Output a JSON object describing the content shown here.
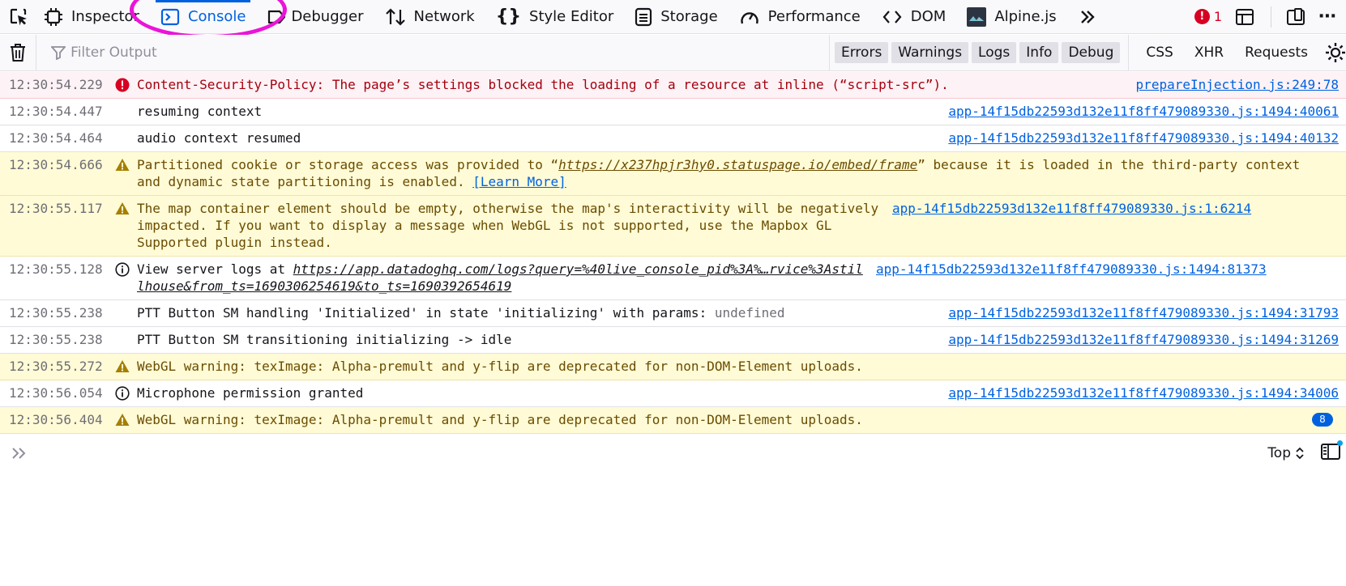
{
  "toolbar": {
    "tabs": [
      {
        "label": "Inspector",
        "icon": "inspector-icon",
        "selected": false
      },
      {
        "label": "Console",
        "icon": "console-icon",
        "selected": true
      },
      {
        "label": "Debugger",
        "icon": "debugger-icon",
        "selected": false
      },
      {
        "label": "Network",
        "icon": "network-icon",
        "selected": false
      },
      {
        "label": "Style Editor",
        "icon": "style-editor-icon",
        "selected": false
      },
      {
        "label": "Storage",
        "icon": "storage-icon",
        "selected": false
      },
      {
        "label": "Performance",
        "icon": "performance-icon",
        "selected": false
      },
      {
        "label": "DOM",
        "icon": "dom-icon",
        "selected": false
      },
      {
        "label": "Alpine.js",
        "icon": "alpine-icon",
        "selected": false
      }
    ],
    "error_count": "1",
    "accent": "#0061e0",
    "annotation_color": "#ea14d8"
  },
  "filter": {
    "placeholder": "Filter Output",
    "levels": [
      "Errors",
      "Warnings",
      "Logs",
      "Info",
      "Debug"
    ],
    "types": [
      "CSS",
      "XHR",
      "Requests"
    ]
  },
  "messages": [
    {
      "type": "error",
      "time": "12:30:54.229",
      "text": "Content-Security-Policy: The page’s settings blocked the loading of a resource at inline (“script-src”).",
      "source": "prepareInjection.js:249:78"
    },
    {
      "type": "log",
      "time": "12:30:54.447",
      "text": "resuming context",
      "source_file": "app-14f15db22593d132e11f8ff479089330.js",
      "source_loc": ":1494:40061"
    },
    {
      "type": "log",
      "time": "12:30:54.464",
      "text": "audio context resumed",
      "source_file": "app-14f15db22593d132e11f8ff479089330.js",
      "source_loc": ":1494:40132"
    },
    {
      "type": "warn",
      "time": "12:30:54.666",
      "text_before": "Partitioned cookie or storage access was provided to “",
      "link": "https://x237hpjr3hy0.statuspage.io/embed/frame",
      "text_after": "” because it is loaded in the third-party context and dynamic state partitioning is enabled. ",
      "learn_more": "[Learn More]"
    },
    {
      "type": "warn",
      "time": "12:30:55.117",
      "text": "The map container element should be empty, otherwise the map's interactivity will be negatively impacted. If you want to display a message when WebGL is not supported, use the Mapbox GL Supported plugin instead.",
      "source_file": "app-14f15db22593d132e11f8ff479089330.js",
      "source_loc": ":1:6214"
    },
    {
      "type": "info",
      "time": "12:30:55.128",
      "text_before": "View server logs at ",
      "link": "https://app.datadoghq.com/logs?query=%40live_console_pid%3A%…rvice%3Astillhouse&from_ts=1690306254619&to_ts=1690392654619",
      "source_file": "app-14f15db22593d132e11f8ff479089330.js",
      "source_loc": ":1494:81373"
    },
    {
      "type": "log",
      "time": "12:30:55.238",
      "text": "PTT Button SM handling 'Initialized' in state 'initializing' with params: ",
      "text_gray": "undefined",
      "source_file": "app-14f15db22593d132e11f8ff479089330.js",
      "source_loc": ":1494:31793"
    },
    {
      "type": "log",
      "time": "12:30:55.238",
      "text": "PTT Button SM transitioning initializing -> idle",
      "source_file": "app-14f15db22593d132e11f8ff479089330.js",
      "source_loc": ":1494:31269"
    },
    {
      "type": "warn",
      "time": "12:30:55.272",
      "text": "WebGL warning: texImage: Alpha-premult and y-flip are deprecated for non-DOM-Element uploads."
    },
    {
      "type": "info",
      "time": "12:30:56.054",
      "text": "Microphone permission granted",
      "source_file": "app-14f15db22593d132e11f8ff479089330.js",
      "source_loc": ":1494:34006"
    },
    {
      "type": "warn",
      "time": "12:30:56.404",
      "text": "WebGL warning: texImage: Alpha-premult and y-flip are deprecated for non-DOM-Element uploads.",
      "repeat": "8"
    }
  ],
  "input": {
    "context": "Top"
  }
}
